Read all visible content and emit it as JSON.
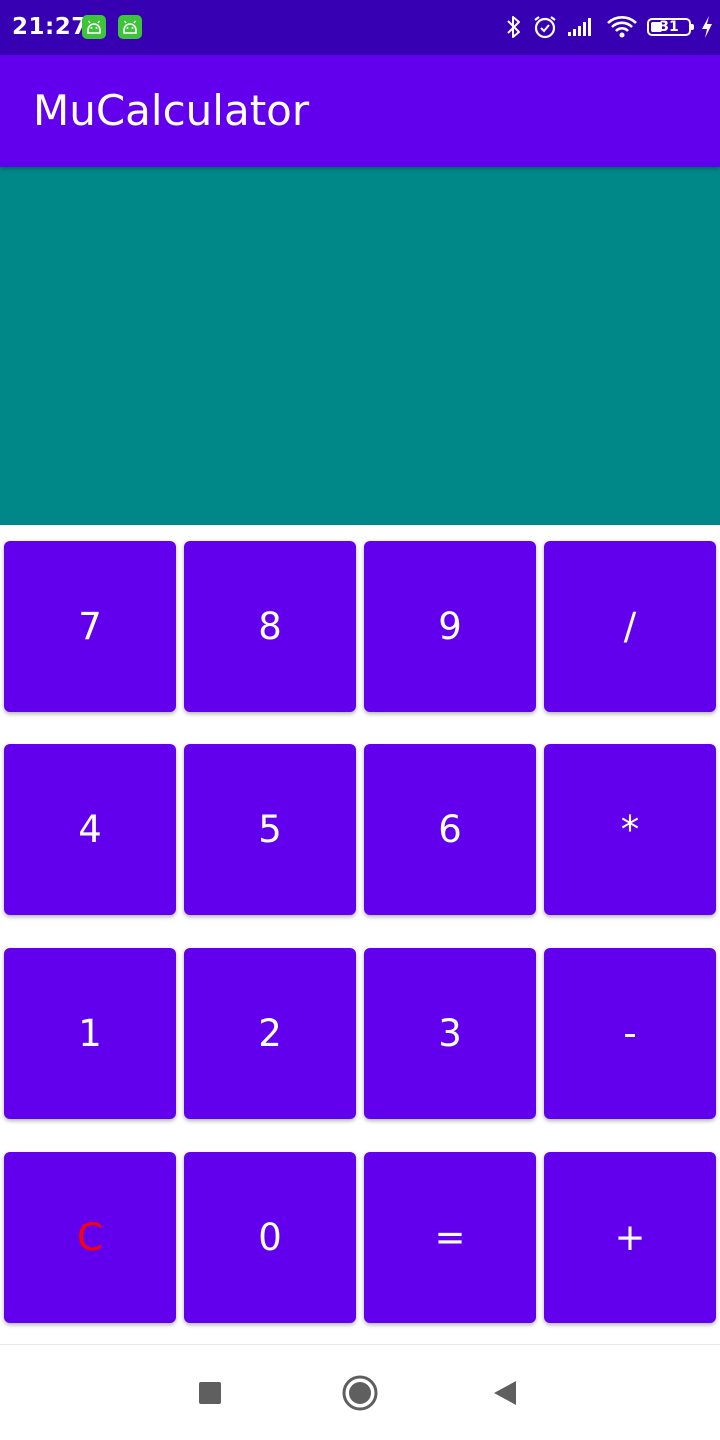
{
  "status_bar": {
    "time": "21:27",
    "notification_icons": [
      "android-app-icon",
      "android-app-icon"
    ],
    "indicator_icons": [
      "bluetooth-icon",
      "alarm-icon",
      "cellular-signal-icon",
      "wifi-icon"
    ],
    "battery_level": "31",
    "charging": true
  },
  "app_bar": {
    "title": "MuCalculator"
  },
  "display": {
    "value": ""
  },
  "keypad": {
    "rows": [
      [
        "7",
        "8",
        "9",
        "/"
      ],
      [
        "4",
        "5",
        "6",
        "*"
      ],
      [
        "1",
        "2",
        "3",
        "-"
      ],
      [
        "C",
        "0",
        "=",
        "+"
      ]
    ]
  },
  "nav_bar": {
    "buttons": [
      "recents-icon",
      "home-icon",
      "back-icon"
    ]
  },
  "colors": {
    "status_bar": "#3700b3",
    "app_bar": "#6200ee",
    "display": "#008888",
    "key": "#6200ee",
    "clear_key_text": "#ff0000"
  }
}
